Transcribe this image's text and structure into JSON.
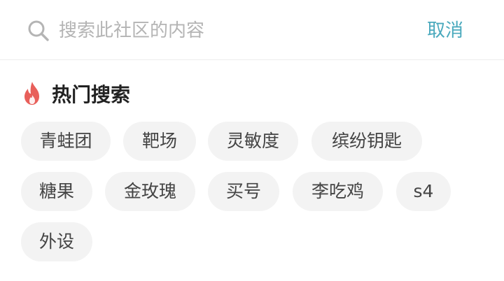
{
  "search": {
    "placeholder": "搜索此社区的内容",
    "value": "",
    "cancel_label": "取消"
  },
  "hot": {
    "title": "热门搜索",
    "tags": [
      "青蛙团",
      "靶场",
      "灵敏度",
      "缤纷钥匙",
      "糖果",
      "金玫瑰",
      "买号",
      "李吃鸡",
      "s4",
      "外设"
    ]
  },
  "colors": {
    "accent": "#4aa9bd",
    "fire": "#e85f5a",
    "tag_bg": "#f3f3f3",
    "placeholder": "#b4b4b4"
  },
  "icons": {
    "search": "search-icon",
    "fire": "fire-icon"
  }
}
